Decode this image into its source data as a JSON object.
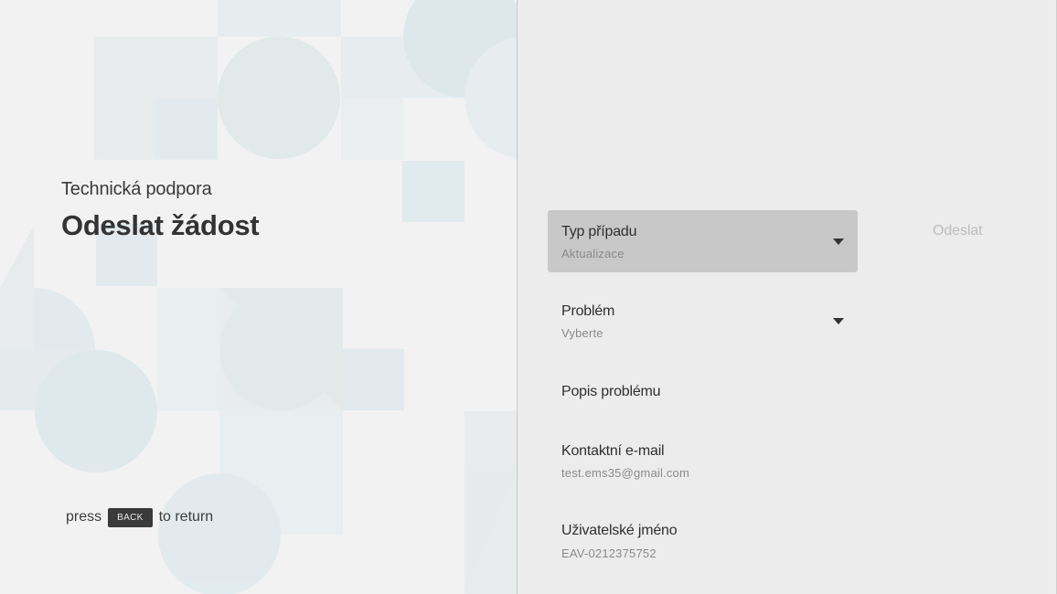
{
  "header": {
    "subtitle": "Technická podpora",
    "title": "Odeslat žádost"
  },
  "hint": {
    "before": "press",
    "key": "BACK",
    "after": "to return"
  },
  "form": {
    "case_type": {
      "label": "Typ případu",
      "value": "Aktualizace"
    },
    "problem": {
      "label": "Problém",
      "value": "Vyberte"
    },
    "description": {
      "label": "Popis problému"
    },
    "email": {
      "label": "Kontaktní e-mail",
      "value": "test.ems35@gmail.com"
    },
    "username": {
      "label": "Uživatelské jméno",
      "value": "EAV-0212375752"
    }
  },
  "actions": {
    "submit_label": "Odeslat"
  },
  "colors": {
    "left_background": "#f2f2f2",
    "right_background": "#ececec",
    "focused_field": "#c8c8c8",
    "pattern_tint": "#dde8ec",
    "disabled_text": "#bdbdbd"
  }
}
